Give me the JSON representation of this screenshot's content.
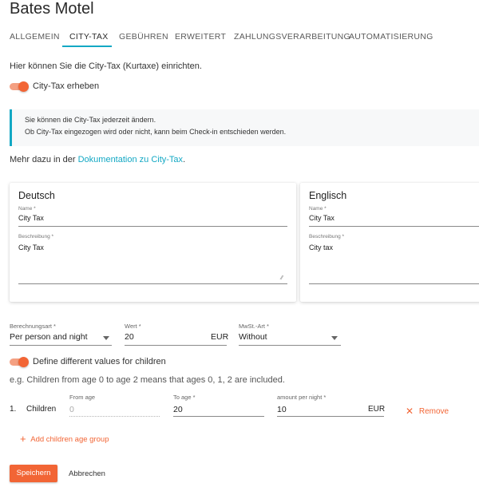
{
  "page": {
    "title": "Bates Motel"
  },
  "tabs": [
    {
      "label": "ALLGEMEIN"
    },
    {
      "label": "CITY-TAX"
    },
    {
      "label": "GEBÜHREN"
    },
    {
      "label": "ERWEITERT"
    },
    {
      "label": "ZAHLUNGSVERARBEITUNG"
    },
    {
      "label": "AUTOMATISIERUNG"
    }
  ],
  "intro": "Hier können Sie die City-Tax (Kurtaxe) einrichten.",
  "city_tax_toggle": {
    "label": "City-Tax erheben",
    "on": true
  },
  "info": {
    "line1": "Sie können die City-Tax jederzeit ändern.",
    "line2": "Ob City-Tax eingezogen wird oder nicht, kann beim Check-in entschieden werden."
  },
  "docs": {
    "prefix": "Mehr dazu in der ",
    "link": "Dokumentation zu City-Tax",
    "suffix": "."
  },
  "cards": {
    "german": {
      "title": "Deutsch",
      "name_label": "Name *",
      "name_value": "City Tax",
      "desc_label": "Beschreibung *",
      "desc_value": "City Tax"
    },
    "english": {
      "title": "Englisch",
      "name_label": "Name *",
      "name_value": "City Tax",
      "desc_label": "Beschreibung *",
      "desc_value": "City tax"
    }
  },
  "calc": {
    "type_label": "Berechnungsart *",
    "type_value": "Per person and night",
    "value_label": "Wert *",
    "value_value": "20",
    "value_unit": "EUR",
    "vat_label": "MwSt.-Art *",
    "vat_value": "Without"
  },
  "children_toggle": {
    "label": "Define different values for children",
    "on": true
  },
  "children_hint": "e.g. Children from age 0 to age 2 means that ages 0, 1, 2 are included.",
  "children_row": {
    "index": "1.",
    "label": "Children",
    "from_label": "From age",
    "from_value": "0",
    "to_label": "To age *",
    "to_value": "20",
    "amount_label": "amount per night *",
    "amount_value": "10",
    "amount_unit": "EUR",
    "remove": "Remove"
  },
  "add_group": "Add children age group",
  "buttons": {
    "save": "Speichern",
    "cancel": "Abbrechen"
  },
  "colors": {
    "accent": "#13a8c4",
    "primary": "#f26535"
  }
}
